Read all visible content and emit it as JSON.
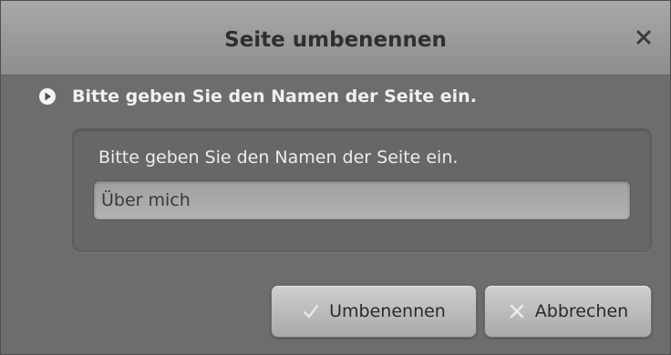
{
  "dialog": {
    "title": "Seite umbenennen",
    "close_icon": "close-icon"
  },
  "prompt": {
    "icon": "play-circle-icon",
    "text": "Bitte geben Sie den Namen der Seite ein."
  },
  "field": {
    "label": "Bitte geben Sie den Namen der Seite ein.",
    "value": "Über mich",
    "placeholder": ""
  },
  "buttons": {
    "rename": {
      "label": "Umbenennen",
      "icon": "checkmark-icon"
    },
    "cancel": {
      "label": "Abbrechen",
      "icon": "x-icon"
    }
  }
}
